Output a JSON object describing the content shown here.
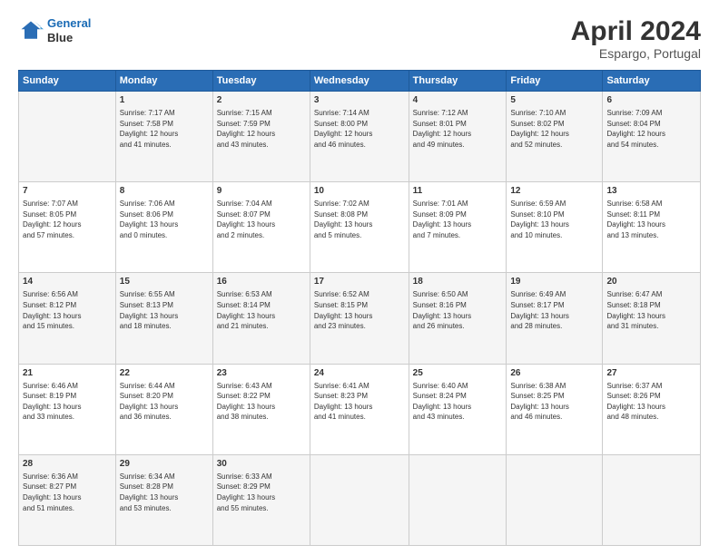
{
  "header": {
    "logo_line1": "General",
    "logo_line2": "Blue",
    "title": "April 2024",
    "subtitle": "Espargo, Portugal"
  },
  "days_of_week": [
    "Sunday",
    "Monday",
    "Tuesday",
    "Wednesday",
    "Thursday",
    "Friday",
    "Saturday"
  ],
  "weeks": [
    [
      {
        "day": "",
        "content": ""
      },
      {
        "day": "1",
        "content": "Sunrise: 7:17 AM\nSunset: 7:58 PM\nDaylight: 12 hours\nand 41 minutes."
      },
      {
        "day": "2",
        "content": "Sunrise: 7:15 AM\nSunset: 7:59 PM\nDaylight: 12 hours\nand 43 minutes."
      },
      {
        "day": "3",
        "content": "Sunrise: 7:14 AM\nSunset: 8:00 PM\nDaylight: 12 hours\nand 46 minutes."
      },
      {
        "day": "4",
        "content": "Sunrise: 7:12 AM\nSunset: 8:01 PM\nDaylight: 12 hours\nand 49 minutes."
      },
      {
        "day": "5",
        "content": "Sunrise: 7:10 AM\nSunset: 8:02 PM\nDaylight: 12 hours\nand 52 minutes."
      },
      {
        "day": "6",
        "content": "Sunrise: 7:09 AM\nSunset: 8:04 PM\nDaylight: 12 hours\nand 54 minutes."
      }
    ],
    [
      {
        "day": "7",
        "content": "Sunrise: 7:07 AM\nSunset: 8:05 PM\nDaylight: 12 hours\nand 57 minutes."
      },
      {
        "day": "8",
        "content": "Sunrise: 7:06 AM\nSunset: 8:06 PM\nDaylight: 13 hours\nand 0 minutes."
      },
      {
        "day": "9",
        "content": "Sunrise: 7:04 AM\nSunset: 8:07 PM\nDaylight: 13 hours\nand 2 minutes."
      },
      {
        "day": "10",
        "content": "Sunrise: 7:02 AM\nSunset: 8:08 PM\nDaylight: 13 hours\nand 5 minutes."
      },
      {
        "day": "11",
        "content": "Sunrise: 7:01 AM\nSunset: 8:09 PM\nDaylight: 13 hours\nand 7 minutes."
      },
      {
        "day": "12",
        "content": "Sunrise: 6:59 AM\nSunset: 8:10 PM\nDaylight: 13 hours\nand 10 minutes."
      },
      {
        "day": "13",
        "content": "Sunrise: 6:58 AM\nSunset: 8:11 PM\nDaylight: 13 hours\nand 13 minutes."
      }
    ],
    [
      {
        "day": "14",
        "content": "Sunrise: 6:56 AM\nSunset: 8:12 PM\nDaylight: 13 hours\nand 15 minutes."
      },
      {
        "day": "15",
        "content": "Sunrise: 6:55 AM\nSunset: 8:13 PM\nDaylight: 13 hours\nand 18 minutes."
      },
      {
        "day": "16",
        "content": "Sunrise: 6:53 AM\nSunset: 8:14 PM\nDaylight: 13 hours\nand 21 minutes."
      },
      {
        "day": "17",
        "content": "Sunrise: 6:52 AM\nSunset: 8:15 PM\nDaylight: 13 hours\nand 23 minutes."
      },
      {
        "day": "18",
        "content": "Sunrise: 6:50 AM\nSunset: 8:16 PM\nDaylight: 13 hours\nand 26 minutes."
      },
      {
        "day": "19",
        "content": "Sunrise: 6:49 AM\nSunset: 8:17 PM\nDaylight: 13 hours\nand 28 minutes."
      },
      {
        "day": "20",
        "content": "Sunrise: 6:47 AM\nSunset: 8:18 PM\nDaylight: 13 hours\nand 31 minutes."
      }
    ],
    [
      {
        "day": "21",
        "content": "Sunrise: 6:46 AM\nSunset: 8:19 PM\nDaylight: 13 hours\nand 33 minutes."
      },
      {
        "day": "22",
        "content": "Sunrise: 6:44 AM\nSunset: 8:20 PM\nDaylight: 13 hours\nand 36 minutes."
      },
      {
        "day": "23",
        "content": "Sunrise: 6:43 AM\nSunset: 8:22 PM\nDaylight: 13 hours\nand 38 minutes."
      },
      {
        "day": "24",
        "content": "Sunrise: 6:41 AM\nSunset: 8:23 PM\nDaylight: 13 hours\nand 41 minutes."
      },
      {
        "day": "25",
        "content": "Sunrise: 6:40 AM\nSunset: 8:24 PM\nDaylight: 13 hours\nand 43 minutes."
      },
      {
        "day": "26",
        "content": "Sunrise: 6:38 AM\nSunset: 8:25 PM\nDaylight: 13 hours\nand 46 minutes."
      },
      {
        "day": "27",
        "content": "Sunrise: 6:37 AM\nSunset: 8:26 PM\nDaylight: 13 hours\nand 48 minutes."
      }
    ],
    [
      {
        "day": "28",
        "content": "Sunrise: 6:36 AM\nSunset: 8:27 PM\nDaylight: 13 hours\nand 51 minutes."
      },
      {
        "day": "29",
        "content": "Sunrise: 6:34 AM\nSunset: 8:28 PM\nDaylight: 13 hours\nand 53 minutes."
      },
      {
        "day": "30",
        "content": "Sunrise: 6:33 AM\nSunset: 8:29 PM\nDaylight: 13 hours\nand 55 minutes."
      },
      {
        "day": "",
        "content": ""
      },
      {
        "day": "",
        "content": ""
      },
      {
        "day": "",
        "content": ""
      },
      {
        "day": "",
        "content": ""
      }
    ]
  ]
}
